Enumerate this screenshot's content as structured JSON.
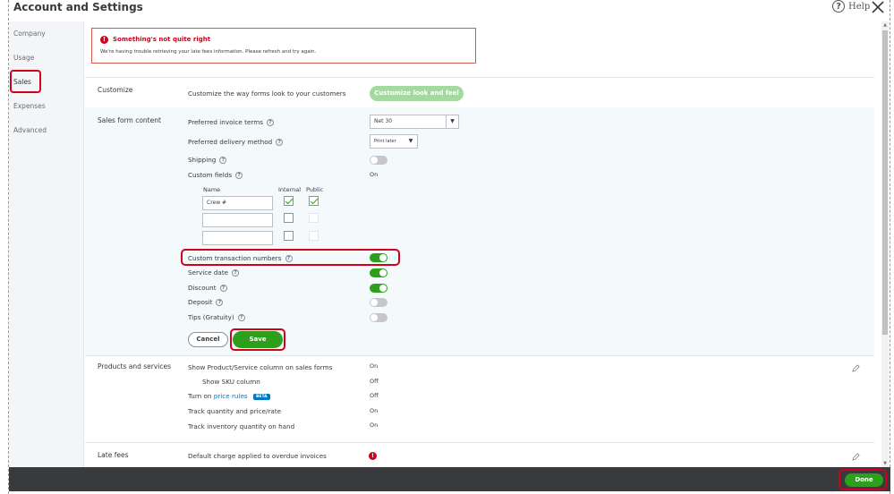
{
  "header": {
    "title": "Account and Settings",
    "help_label": "Help",
    "help_icon": "question-circle-icon",
    "close_icon": "close-icon"
  },
  "sidebar": {
    "items": [
      {
        "label": "Company"
      },
      {
        "label": "Usage"
      },
      {
        "label": "Sales",
        "selected": true
      },
      {
        "label": "Expenses"
      },
      {
        "label": "Advanced"
      }
    ]
  },
  "error": {
    "title": "Something's not quite right",
    "message": "We're having trouble retrieving your late fees information. Please refresh and try again."
  },
  "customize": {
    "label": "Customize",
    "description": "Customize the way forms look to your customers",
    "button": "Customize look and feel"
  },
  "sales_form": {
    "label": "Sales form content",
    "invoice_terms": {
      "label": "Preferred invoice terms",
      "value": "Net 30"
    },
    "delivery_method": {
      "label": "Preferred delivery method",
      "value": "Print later"
    },
    "shipping": {
      "label": "Shipping",
      "on": false
    },
    "custom_fields": {
      "label": "Custom fields",
      "status": "On",
      "headers": {
        "name": "Name",
        "internal": "Internal",
        "public": "Public"
      },
      "rows": [
        {
          "name": "Crew #",
          "internal": true,
          "public": true
        },
        {
          "name": "",
          "internal": false,
          "public": false
        },
        {
          "name": "",
          "internal": false,
          "public": false
        }
      ]
    },
    "custom_txn_numbers": {
      "label": "Custom transaction numbers",
      "on": true
    },
    "service_date": {
      "label": "Service date",
      "on": true
    },
    "discount": {
      "label": "Discount",
      "on": true
    },
    "deposit": {
      "label": "Deposit",
      "on": false
    },
    "tips": {
      "label": "Tips (Gratuity)",
      "on": false
    },
    "cancel_label": "Cancel",
    "save_label": "Save"
  },
  "products": {
    "label": "Products and services",
    "rows": [
      {
        "label": "Show Product/Service column on sales forms",
        "value": "On"
      },
      {
        "label": "Show SKU column",
        "value": "Off"
      },
      {
        "label_prefix": "Turn on",
        "link": "price rules",
        "badge": "BETA",
        "value": "Off"
      },
      {
        "label": "Track quantity and price/rate",
        "value": "On"
      },
      {
        "label": "Track inventory quantity on hand",
        "value": "On"
      }
    ]
  },
  "late_fees": {
    "label": "Late fees",
    "row_label": "Default charge applied to overdue invoices"
  },
  "footer": {
    "done_label": "Done"
  },
  "colors": {
    "accent_green": "#2ca01c",
    "error_red": "#d0021b",
    "link_blue": "#0077c5",
    "footer_bg": "#393a3d"
  }
}
